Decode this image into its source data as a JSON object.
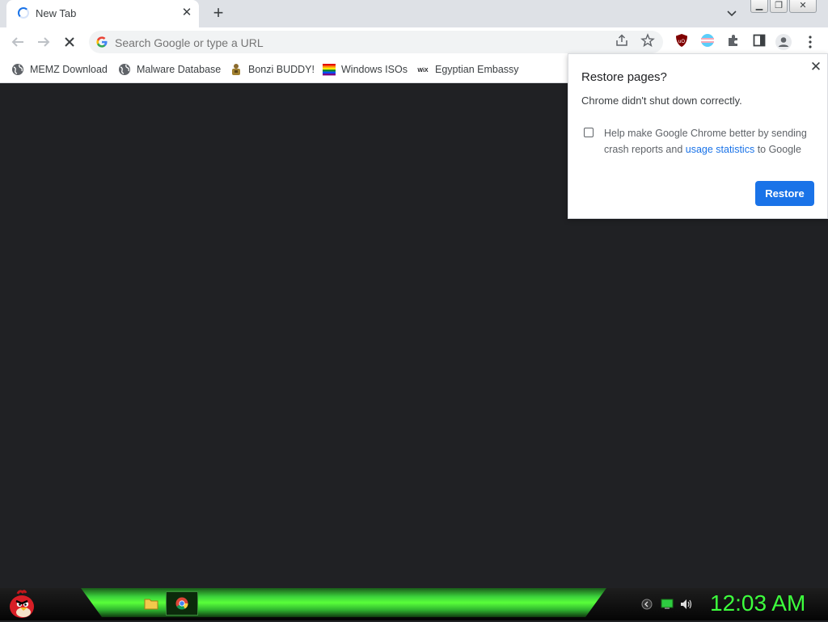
{
  "tab": {
    "title": "New Tab",
    "close_glyph": "✕"
  },
  "tab_strip": {
    "new_tab_glyph": "+"
  },
  "window_controls": {
    "minimize": "▁",
    "restore": "❐",
    "close": "✕"
  },
  "toolbar": {
    "omnibox_placeholder": "Search Google or type a URL",
    "icons": [
      "back-icon",
      "forward-icon",
      "stop-icon",
      "share-icon",
      "star-icon",
      "ublock-icon",
      "extension-flag-icon",
      "puzzle-icon",
      "side-panel-icon",
      "profile-icon",
      "menu-icon"
    ]
  },
  "bookmarks": [
    {
      "label": "MEMZ Download",
      "icon": "globe-icon"
    },
    {
      "label": "Malware Database",
      "icon": "globe-icon"
    },
    {
      "label": "Bonzi BUDDY!",
      "icon": "bonzi-icon"
    },
    {
      "label": "Windows ISOs",
      "icon": "rainbow-flag-icon"
    },
    {
      "label": "Egyptian Embassy",
      "icon": "wix-icon"
    }
  ],
  "restore_bubble": {
    "title": "Restore pages?",
    "message": "Chrome didn't shut down correctly.",
    "checkbox_text_before": "Help make Google Chrome better by sending crash reports and ",
    "checkbox_link": "usage statistics",
    "checkbox_text_after": " to Google",
    "checkbox_checked": false,
    "button": "Restore",
    "close_glyph": "✕"
  },
  "taskbar": {
    "clock": "12:03 AM",
    "accent_color": "#3dff3d"
  },
  "colors": {
    "content_bg": "#202124",
    "accent_blue": "#1a73e8"
  }
}
